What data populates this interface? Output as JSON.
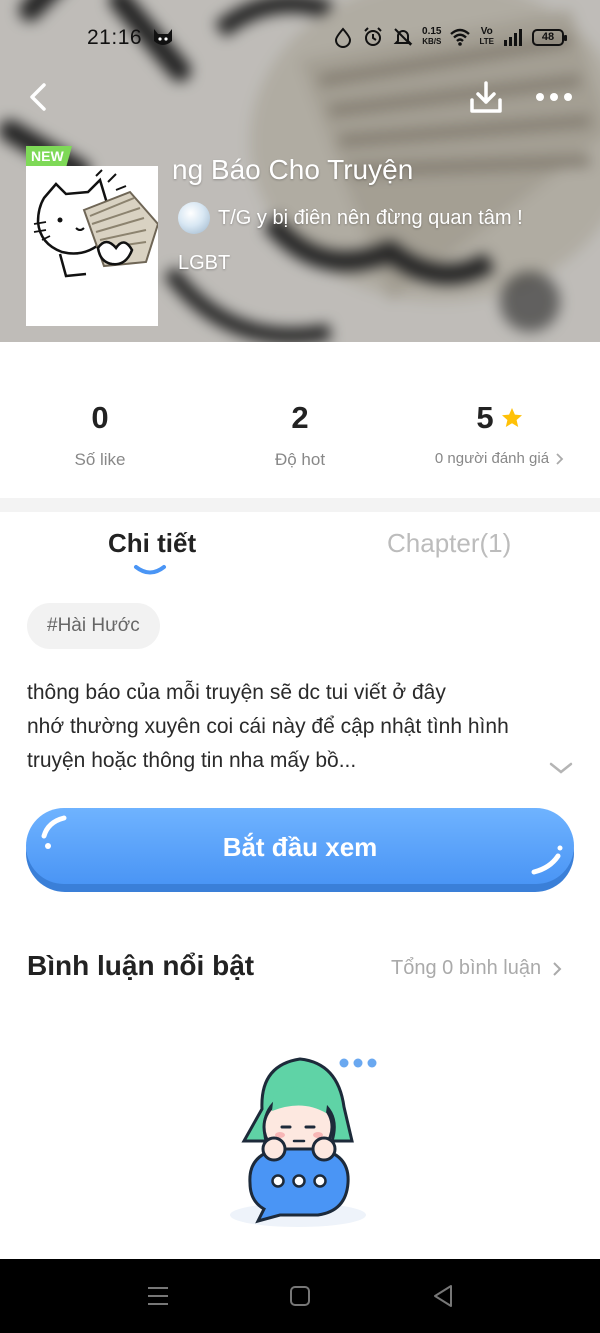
{
  "status_bar": {
    "time": "21:16",
    "net_speed_value": "0.15",
    "net_speed_unit": "KB/S",
    "volte_top": "Vo",
    "volte_bottom": "LTE",
    "battery": "48",
    "icons": [
      "cat-icon",
      "water-drop-icon",
      "alarm-icon",
      "mute-icon",
      "wifi-icon",
      "volte-icon",
      "signal-icon",
      "battery-icon"
    ]
  },
  "header": {
    "icons": [
      "back-icon",
      "download-icon",
      "more-icon"
    ]
  },
  "story": {
    "badge": "NEW",
    "title": "ng Báo Cho Truyện",
    "author_line": "T/G  y bị điên nên đừng quan tâm !",
    "tagline": "LGBT"
  },
  "stats": {
    "likes_value": "0",
    "likes_label": "Số like",
    "hot_value": "2",
    "hot_label": "Độ hot",
    "rating_value": "5",
    "rating_label": "0 người đánh giá"
  },
  "tabs": [
    {
      "label": "Chi tiết",
      "active": true
    },
    {
      "label": "Chapter(1)",
      "active": false
    }
  ],
  "tag": "#Hài Hước",
  "description": [
    "thông báo của mỗi truyện sẽ dc tui viết ở đây",
    "nhớ thường xuyên coi cái này để cập nhật tình hình",
    "truyện hoặc thông tin nha mấy bồ..."
  ],
  "start_button": "Bắt đầu xem",
  "comments": {
    "title": "Bình luận nổi bật",
    "total": "Tổng 0 bình luận"
  },
  "colors": {
    "accent_blue": "#4a95f5",
    "badge_green": "#7ed957",
    "star_yellow": "#ffc107",
    "mascot_green": "#5fd3a6"
  }
}
